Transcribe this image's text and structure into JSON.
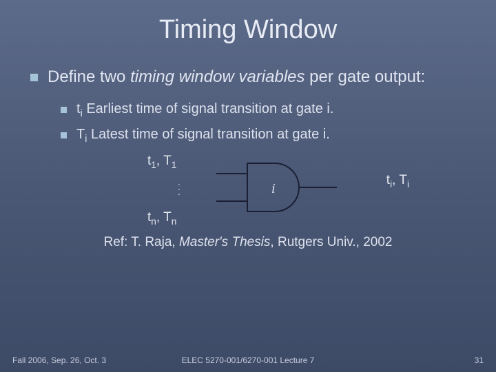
{
  "title": "Timing Window",
  "main_point": {
    "prefix": "Define two ",
    "italic": "timing window variables",
    "suffix": " per gate output:"
  },
  "sub1": {
    "var": "t",
    "sub": "i",
    "desc": "  Earliest time of signal transition at gate i."
  },
  "sub2": {
    "var": "T",
    "sub": "i",
    "desc": " Latest time of signal transition at gate i."
  },
  "diagram": {
    "top": {
      "a": "t",
      "asub": "1",
      "b": "T",
      "bsub": "1"
    },
    "bot": {
      "a": "t",
      "asub": "n",
      "b": "T",
      "bsub": "n"
    },
    "gate_label": "i",
    "out": {
      "a": "t",
      "asub": "i",
      "b": "T",
      "bsub": "i"
    }
  },
  "reference": {
    "prefix": "Ref: T. Raja, ",
    "italic": "Master's Thesis",
    "suffix": ", Rutgers Univ., 2002"
  },
  "footer": {
    "left": "Fall 2006, Sep. 26, Oct. 3",
    "mid": "ELEC 5270-001/6270-001 Lecture 7",
    "right": "31"
  }
}
